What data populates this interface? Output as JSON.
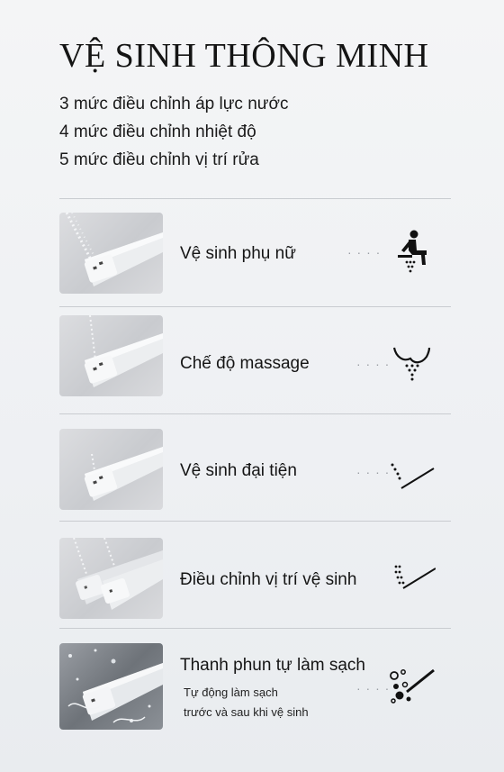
{
  "title": "VỆ SINH THÔNG MINH",
  "specs": [
    "3 mức điều chỉnh áp lực nước",
    "4 mức điều chỉnh nhiệt độ",
    "5 mức điều chỉnh vị trí rửa"
  ],
  "features": [
    {
      "label": "Vệ sinh phụ nữ",
      "icon": "sitting-person-spray-icon",
      "dots": "· · · ·"
    },
    {
      "label": "Chế độ massage",
      "icon": "massage-spray-icon",
      "dots": "· · · ·"
    },
    {
      "label": "Vệ sinh đại tiện",
      "icon": "rear-spray-icon",
      "dots": "· · · ·"
    },
    {
      "label": "Điều chỉnh vị trí vệ sinh",
      "icon": "position-adjust-icon",
      "dots": ""
    },
    {
      "label": "Thanh phun tự làm sạch",
      "sub1": "Tự động làm sạch",
      "sub2": "trước và sau khi vệ sinh",
      "icon": "self-clean-nozzle-icon",
      "dots": "· · · ·"
    }
  ]
}
